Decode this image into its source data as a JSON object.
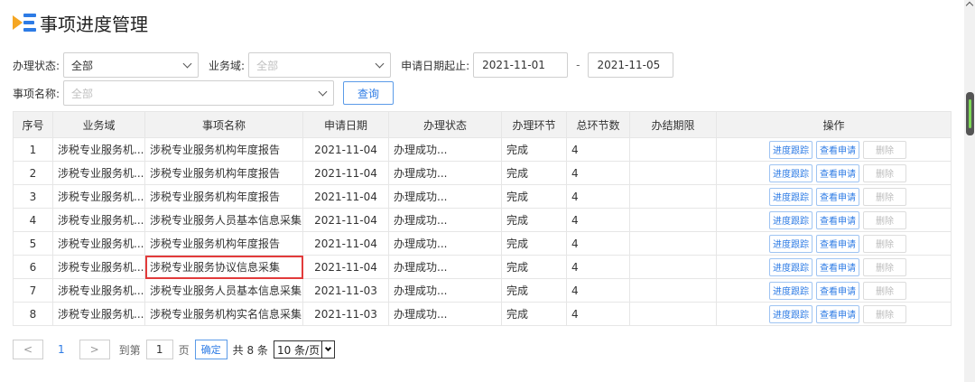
{
  "page": {
    "title": "事项进度管理"
  },
  "filters": {
    "status_label": "办理状态:",
    "status_value": "全部",
    "domain_label": "业务域:",
    "domain_placeholder": "全部",
    "date_label": "申请日期起止:",
    "date_start": "2021-11-01",
    "date_sep": "-",
    "date_end": "2021-11-05",
    "name_label": "事项名称:",
    "name_placeholder": "全部",
    "query_button": "查询"
  },
  "table": {
    "columns": [
      "序号",
      "业务域",
      "事项名称",
      "申请日期",
      "办理状态",
      "办理环节",
      "总环节数",
      "办结期限",
      "操作"
    ],
    "rows": [
      {
        "no": "1",
        "domain": "涉税专业服务机...",
        "name": "涉税专业服务机构年度报告",
        "date": "2021-11-04",
        "status": "办理成功...",
        "step": "完成",
        "total": "4",
        "deadline": ""
      },
      {
        "no": "2",
        "domain": "涉税专业服务机...",
        "name": "涉税专业服务机构年度报告",
        "date": "2021-11-04",
        "status": "办理成功...",
        "step": "完成",
        "total": "4",
        "deadline": ""
      },
      {
        "no": "3",
        "domain": "涉税专业服务机...",
        "name": "涉税专业服务机构年度报告",
        "date": "2021-11-04",
        "status": "办理成功...",
        "step": "完成",
        "total": "4",
        "deadline": ""
      },
      {
        "no": "4",
        "domain": "涉税专业服务机...",
        "name": "涉税专业服务人员基本信息采集",
        "date": "2021-11-04",
        "status": "办理成功...",
        "step": "完成",
        "total": "4",
        "deadline": ""
      },
      {
        "no": "5",
        "domain": "涉税专业服务机...",
        "name": "涉税专业服务机构年度报告",
        "date": "2021-11-04",
        "status": "办理成功...",
        "step": "完成",
        "total": "4",
        "deadline": ""
      },
      {
        "no": "6",
        "domain": "涉税专业服务机...",
        "name": "涉税专业服务协议信息采集",
        "date": "2021-11-04",
        "status": "办理成功...",
        "step": "完成",
        "total": "4",
        "deadline": ""
      },
      {
        "no": "7",
        "domain": "涉税专业服务机...",
        "name": "涉税专业服务人员基本信息采集",
        "date": "2021-11-03",
        "status": "办理成功...",
        "step": "完成",
        "total": "4",
        "deadline": ""
      },
      {
        "no": "8",
        "domain": "涉税专业服务机...",
        "name": "涉税专业服务机构实名信息采集",
        "date": "2021-11-03",
        "status": "办理成功...",
        "step": "完成",
        "total": "4",
        "deadline": ""
      }
    ],
    "op_track": "进度跟踪",
    "op_view": "查看申请",
    "op_delete": "删除",
    "highlighted_row": 6,
    "highlight_color": "#e23b3b"
  },
  "pagination": {
    "prev": "<",
    "current_page": "1",
    "next": ">",
    "goto_label": "到第",
    "goto_value": "1",
    "page_suffix": "页",
    "confirm": "确定",
    "total": "共 8 条",
    "page_size": "10 条/页"
  },
  "colors": {
    "accent": "#2d7be5",
    "logo_orange": "#f5a623"
  }
}
